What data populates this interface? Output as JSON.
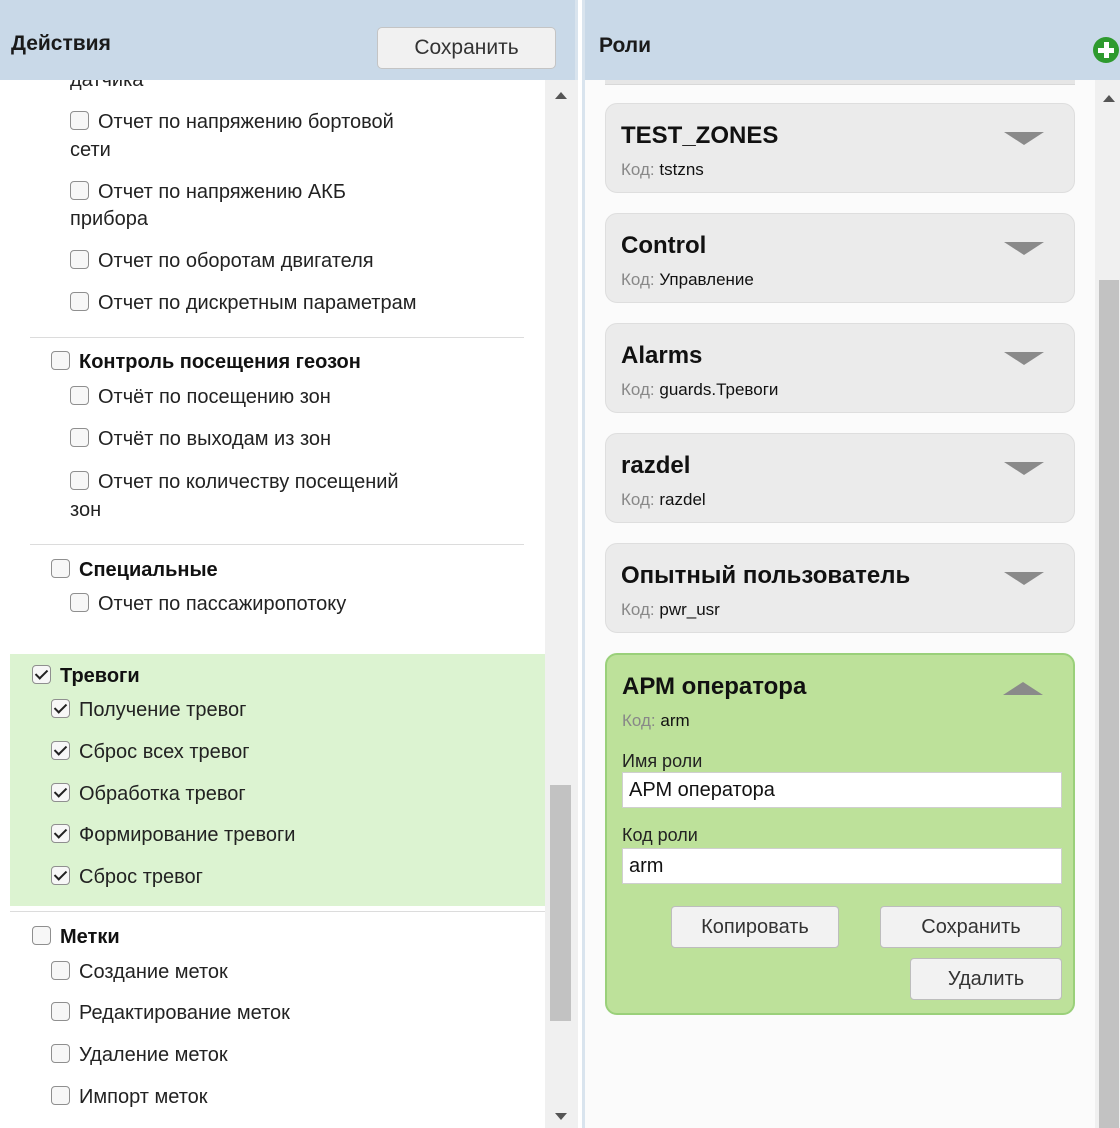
{
  "left": {
    "title": "Действия",
    "save_label": "Сохранить",
    "items": {
      "cut_top": "датчика",
      "onboard_voltage_l1": "Отчет по напряжению бортовой",
      "onboard_voltage_l2": "сети",
      "akb_voltage_l1": "Отчет по напряжению АКБ",
      "akb_voltage_l2": "прибора",
      "engine_rpm": "Отчет по оборотам двигателя",
      "discrete_params": "Отчет по дискретным параметрам",
      "geozone_group": "Контроль посещения геозон",
      "zone_visits": "Отчёт по посещению зон",
      "zone_exits": "Отчёт по выходам из зон",
      "visit_count_l1": "Отчет по количеству посещений",
      "visit_count_l2": "зон",
      "special_group": "Специальные",
      "passenger_flow": "Отчет по пассажиропотоку",
      "alarms_group": "Тревоги",
      "alarm_receive": "Получение тревог",
      "alarm_reset_all": "Сброс всех тревог",
      "alarm_process": "Обработка тревог",
      "alarm_create": "Формирование тревоги",
      "alarm_reset": "Сброс тревог",
      "marks_group": "Метки",
      "mark_create": "Создание меток",
      "mark_edit": "Редактирование меток",
      "mark_delete": "Удаление меток",
      "mark_import": "Импорт меток"
    },
    "checked": {
      "alarms_group": true,
      "alarm_receive": true,
      "alarm_reset_all": true,
      "alarm_process": true,
      "alarm_create": true,
      "alarm_reset": true
    }
  },
  "right": {
    "title": "Роли",
    "code_label": "Код:",
    "roles": [
      {
        "name": "TEST_ZONES",
        "code": "tstzns"
      },
      {
        "name": "Control",
        "code": "Управление"
      },
      {
        "name": "Alarms",
        "code": "guards.Тревоги"
      },
      {
        "name": "razdel",
        "code": "razdel"
      },
      {
        "name": "Опытный пользователь",
        "code": "pwr_usr"
      },
      {
        "name": "АРМ оператора",
        "code": "arm"
      }
    ],
    "active": {
      "role_name_label": "Имя роли",
      "role_name_value": "АРМ оператора",
      "role_code_label": "Код роли",
      "role_code_value": "arm",
      "copy_label": "Копировать",
      "save_label": "Сохранить",
      "delete_label": "Удалить"
    }
  },
  "colors": {
    "header_bg": "#c9d9e8",
    "checked_section_bg": "#dcf3d1",
    "active_card_bg": "#bde19a",
    "card_bg": "#ebebeb",
    "add_icon": "#2e9a2e"
  },
  "icons": [
    "checkbox-icon",
    "add-role-icon",
    "chevron-down-icon",
    "chevron-up-icon",
    "scroll-up-icon",
    "scroll-down-icon"
  ]
}
